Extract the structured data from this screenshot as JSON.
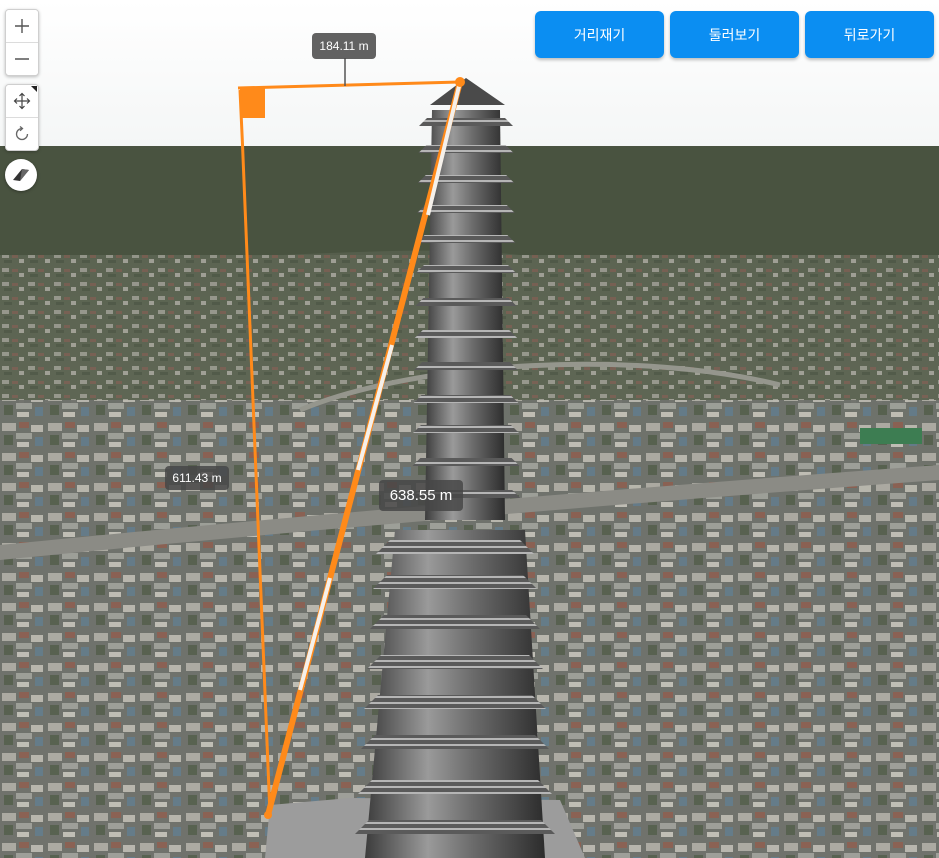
{
  "toolbar": {
    "measure_distance_label": "거리재기",
    "look_around_label": "둘러보기",
    "go_back_label": "뒤로가기"
  },
  "measurements": {
    "horizontal": "184.11 m",
    "vertical": "611.43 m",
    "direct": "638.55 m"
  },
  "colors": {
    "button_blue": "#0b8ef2",
    "measure_orange": "#ff8a1a",
    "label_bg": "#464646"
  },
  "controls": {
    "zoom_in_icon": "plus-icon",
    "zoom_out_icon": "minus-icon",
    "pan_icon": "move-arrows-icon",
    "rotate_icon": "rotate-icon",
    "compass_icon": "compass-icon"
  }
}
